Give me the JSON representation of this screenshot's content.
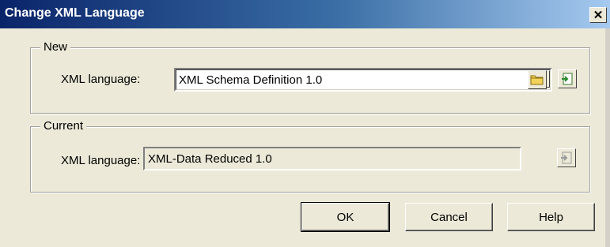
{
  "window": {
    "title": "Change XML Language",
    "close_glyph": "✕"
  },
  "new_group": {
    "legend": "New",
    "label": "XML language:",
    "value": "XML Schema Definition 1.0"
  },
  "current_group": {
    "legend": "Current",
    "label": "XML language:",
    "value": "XML-Data Reduced 1.0"
  },
  "buttons": {
    "ok": "OK",
    "cancel": "Cancel",
    "help": "Help"
  },
  "icons": {
    "browse": "folder-icon",
    "properties": "properties-icon",
    "dropdown": "chevron-down-icon"
  }
}
